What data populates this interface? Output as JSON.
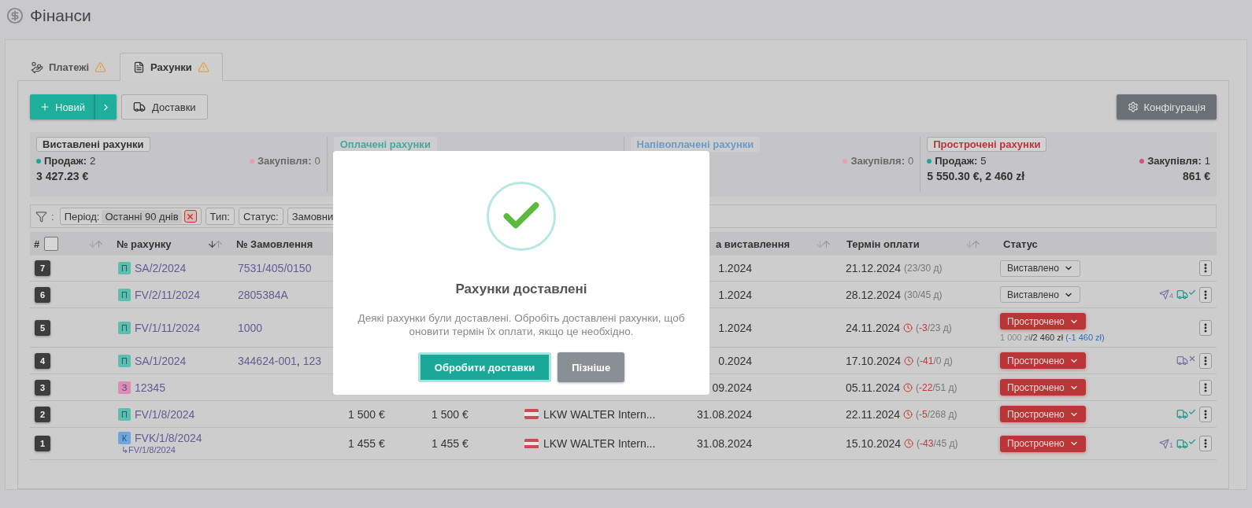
{
  "page": {
    "title": "Фінанси"
  },
  "tabs": [
    {
      "label": "Платежі",
      "selected": false,
      "warning": true
    },
    {
      "label": "Рахунки",
      "selected": true,
      "warning": true
    }
  ],
  "toolbar": {
    "new_button": "Новий",
    "deliveries_button": "Доставки",
    "config_button": "Конфігурація"
  },
  "summary": [
    {
      "title": "Виставлені рахунки",
      "color": "#333333",
      "faded": false,
      "sales_label": "Продаж:",
      "sales_count": "2",
      "sales_total": "3 427.23 €",
      "purchases_label": "Закупівля:",
      "purchases_count": "0",
      "purchases_muted": true
    },
    {
      "title": "Оплачені рахунки",
      "color": "#4aa89b",
      "faded": true
    },
    {
      "title": "Напівоплачені рахунки",
      "color": "#6d9cc4",
      "faded": true,
      "purchases_label": "Закупівля:",
      "purchases_count": "0",
      "purchases_muted": true
    },
    {
      "title": "Прострочені рахунки",
      "color": "#b93538",
      "faded": false,
      "sales_label": "Продаж:",
      "sales_count": "5",
      "sales_total": "5 550.30 €, 2 460 zł",
      "purchases_label": "Закупівля:",
      "purchases_count": "1",
      "purchases_muted": false,
      "purchases_total": "861 €"
    }
  ],
  "filters": {
    "icon_suffix": ":",
    "chips": [
      {
        "label": "Період:",
        "value": "Останні 90 днів",
        "removable": true
      },
      {
        "label": "Тип:",
        "removable": false
      },
      {
        "label": "Статус:",
        "removable": false
      },
      {
        "label": "Замовни",
        "removable": false
      }
    ]
  },
  "table": {
    "select_all": {
      "checked": false
    },
    "columns": [
      {
        "label": "#",
        "sort_desc": false
      },
      {
        "label": "№ рахунку",
        "sort_desc": true
      },
      {
        "label": "№ Замовлення"
      },
      {
        "label": "а виставлення",
        "sort_desc": false
      },
      {
        "label": "Термін оплати",
        "sort_desc": false
      },
      {
        "label": "Статус"
      }
    ],
    "rows": [
      {
        "number": "7",
        "type": "П",
        "color": "#5dbdaf",
        "invoice": "SA/2/2024",
        "orders": [
          {
            "kind": "link",
            "text": "7531/405/0150"
          }
        ],
        "issue_date": "1.2024",
        "due_date": "21.12.2024",
        "overdue": false,
        "due_detail": [
          {
            "kind": "plain",
            "text": "(23/30 д)"
          }
        ],
        "status": "Виставлено",
        "kind": "issued",
        "icons": []
      },
      {
        "number": "6",
        "type": "П",
        "color": "#5dbdaf",
        "invoice": "FV/2/11/2024",
        "orders": [
          {
            "kind": "link",
            "text": "2805384A"
          }
        ],
        "issue_date": "1.2024",
        "due_date": "28.12.2024",
        "overdue": false,
        "due_detail": [
          {
            "kind": "plain",
            "text": "(30/45 д)"
          }
        ],
        "status": "Виставлено",
        "kind": "issued",
        "icons": [
          {
            "kind": "sent",
            "count": "4"
          },
          {
            "kind": "delivered"
          }
        ]
      },
      {
        "number": "5",
        "type": "П",
        "color": "#5dbdaf",
        "invoice": "FV/1/11/2024",
        "orders": [
          {
            "kind": "link",
            "text": "1000"
          }
        ],
        "issue_date": "1.2024",
        "due_date": "24.11.2024",
        "overdue": true,
        "due_detail": [
          {
            "kind": "plain",
            "text": "("
          },
          {
            "kind": "late",
            "text": "-3"
          },
          {
            "kind": "plain",
            "text": "/23 д)"
          }
        ],
        "status": "Прострочено",
        "kind": "overdue",
        "payment": [
          {
            "kind": "muted",
            "text": "1 000 zł"
          },
          {
            "kind": "plain",
            "text": "/2 460 zł"
          },
          {
            "kind": "link",
            "text": " (-1 460 zł)"
          }
        ],
        "icons": []
      },
      {
        "number": "4",
        "type": "П",
        "color": "#5dbdaf",
        "invoice": "SA/1/2024",
        "orders": [
          {
            "kind": "link",
            "text": "344624-001"
          },
          {
            "kind": "plain",
            "text": ","
          },
          {
            "kind": "link",
            "text": "123"
          }
        ],
        "issue_date": "0.2024",
        "due_date": "17.10.2024",
        "overdue": true,
        "due_detail": [
          {
            "kind": "plain",
            "text": "("
          },
          {
            "kind": "late",
            "text": "-41"
          },
          {
            "kind": "plain",
            "text": "/0 д)"
          }
        ],
        "status": "Прострочено",
        "kind": "overdue",
        "icons": [
          {
            "kind": "undelivered"
          }
        ]
      },
      {
        "number": "3",
        "type": "З",
        "color": "#e08bb5",
        "invoice": "12345",
        "orders": [],
        "issue_date": "09.2024",
        "due_date": "05.11.2024",
        "overdue": true,
        "due_detail": [
          {
            "kind": "plain",
            "text": "("
          },
          {
            "kind": "late",
            "text": "-22"
          },
          {
            "kind": "plain",
            "text": "/51 д)"
          }
        ],
        "status": "Прострочено",
        "kind": "overdue",
        "icons": []
      },
      {
        "number": "2",
        "type": "П",
        "color": "#5dbdaf",
        "invoice": "FV/1/8/2024",
        "orders": [],
        "amount_1": "1 500 €",
        "amount_2": "1 500 €",
        "customer": "LKW WALTER Intern...",
        "issue_date": "31.08.2024",
        "due_date": "22.11.2024",
        "overdue": true,
        "due_detail": [
          {
            "kind": "plain",
            "text": "("
          },
          {
            "kind": "late",
            "text": "-5"
          },
          {
            "kind": "plain",
            "text": "/268 д)"
          }
        ],
        "status": "Прострочено",
        "kind": "overdue",
        "icons": [
          {
            "kind": "delivered"
          }
        ]
      },
      {
        "number": "1",
        "type": "К",
        "color": "#6fa6e0",
        "invoice": "FVK/1/8/2024",
        "corrects": "↳FV/1/8/2024",
        "orders": [],
        "amount_1": "1 455 €",
        "amount_2": "1 455 €",
        "customer": "LKW WALTER Intern...",
        "issue_date": "31.08.2024",
        "due_date": "15.10.2024",
        "overdue": true,
        "due_detail": [
          {
            "kind": "plain",
            "text": "("
          },
          {
            "kind": "late",
            "text": "-43"
          },
          {
            "kind": "plain",
            "text": "/45 д)"
          }
        ],
        "status": "Прострочено",
        "kind": "overdue",
        "icons": [
          {
            "kind": "sent",
            "count": "1"
          },
          {
            "kind": "delivered"
          }
        ]
      }
    ]
  },
  "modal": {
    "title": "Рахунки доставлені",
    "message": "Деякі рахунки були доставлені. Обробіть доставлені рахунки, щоб оновити термін їх оплати, якщо це необхідно.",
    "buttons": [
      {
        "label": "Обробити доставки",
        "kind": "primary"
      },
      {
        "label": "Пізніше",
        "kind": "secondary"
      }
    ]
  }
}
